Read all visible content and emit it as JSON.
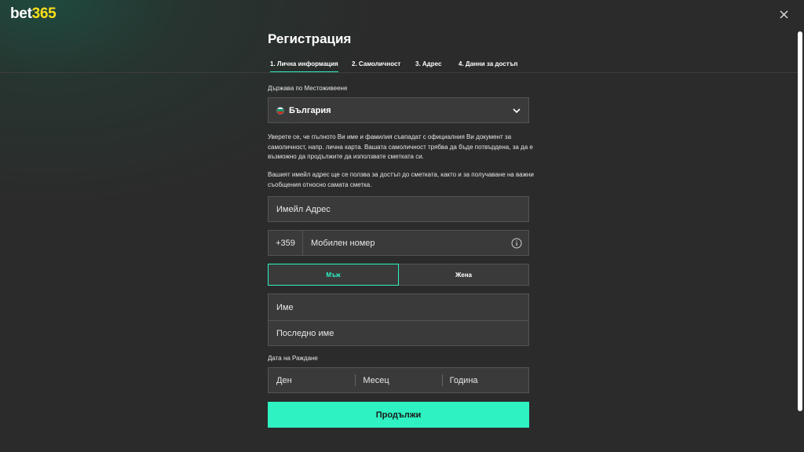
{
  "brand": {
    "logo_main": "bet",
    "logo_accent": "365"
  },
  "title": "Регистрация",
  "tabs": [
    {
      "label": "1. Лична информация",
      "active": true
    },
    {
      "label": "2. Самоличност",
      "active": false
    },
    {
      "label": "3. Адрес",
      "active": false
    },
    {
      "label": "4. Данни за достъп",
      "active": false
    }
  ],
  "country": {
    "label": "Държава по Местоживеене",
    "value": "България",
    "icon": "chevron-down-icon"
  },
  "info": {
    "identity_text": "Уверете се, че пълното Ви име и фамилия съвпадат с официалния Ви документ за самоличност, напр. лична карта. Вашата самоличност трябва да бъде потвърдена, за да е възможно да продължите да използвате сметката си.",
    "email_text": "Вашият имейл адрес ще се ползва за достъп до сметката, както и за получаване на важни съобщения относно самата сметка."
  },
  "email": {
    "placeholder": "Имейл Адрес"
  },
  "phone": {
    "code": "+359",
    "placeholder": "Мобилен номер",
    "icon": "info-icon"
  },
  "gender": {
    "male": "Мъж",
    "female": "Жена",
    "selected": "male"
  },
  "name": {
    "first_placeholder": "Име",
    "last_placeholder": "Последно име"
  },
  "dob": {
    "label": "Дата на Раждане",
    "day": "Ден",
    "month": "Месец",
    "year": "Година"
  },
  "continue_label": "Продължи",
  "colors": {
    "accent": "#2ef2c1",
    "logo_yellow": "#ffdf1b",
    "background": "#2b2b2b",
    "field": "#3a3a3a"
  }
}
